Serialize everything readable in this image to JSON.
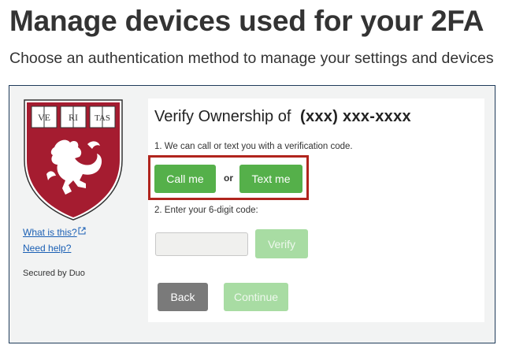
{
  "header": {
    "title": "Manage devices used for your 2FA",
    "subtitle": "Choose an authentication method to manage your settings and devices"
  },
  "logo": {
    "books": [
      "VE",
      "RI",
      "TAS"
    ],
    "colors": {
      "crimson": "#a51c30",
      "navy": "#1f3b5a"
    }
  },
  "sidebar": {
    "what_is_this": "What is this?",
    "need_help": "Need help?",
    "secured_by": "Secured by Duo"
  },
  "verify": {
    "title": "Verify Ownership of",
    "phone": "(xxx) xxx-xxxx",
    "step1": "1. We can call or text you with a verification code.",
    "call_label": "Call me",
    "or_label": "or",
    "text_label": "Text me",
    "step2": "2. Enter your 6-digit code:",
    "code_value": "",
    "verify_label": "Verify",
    "back_label": "Back",
    "continue_label": "Continue"
  },
  "colors": {
    "green": "#55b04a",
    "green_disabled": "#a8dca3",
    "back_gray": "#7a7a7a",
    "highlight_red": "#b0241d",
    "link_blue": "#1a5fb4"
  }
}
